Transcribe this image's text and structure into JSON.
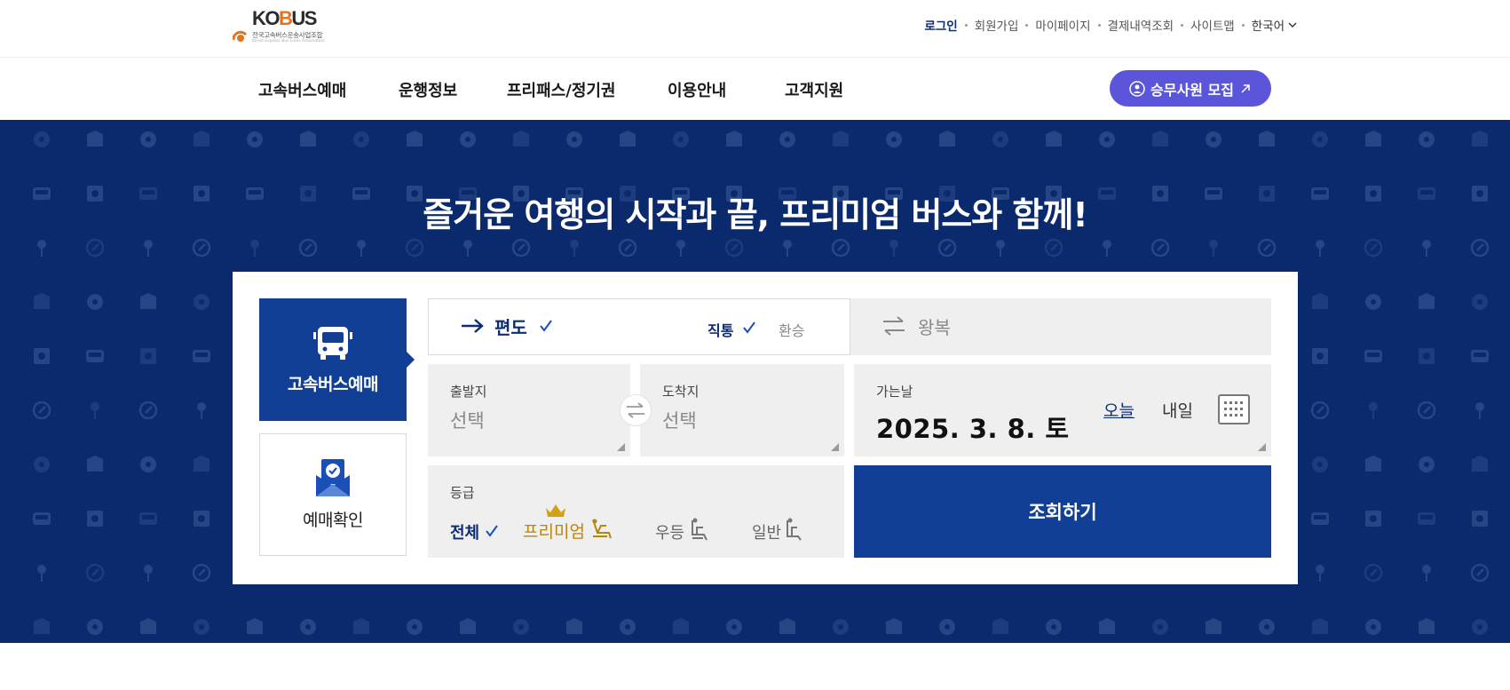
{
  "brand": {
    "logo_text_a": "KO",
    "logo_text_b": "B",
    "logo_text_c": "US",
    "logo_subtitle": "전국고속버스운송사업조합",
    "logo_subtitle_small": "Korea Express Bus Lines Association",
    "brand_color": "#0b2a6e",
    "accent_color": "#5a55d9"
  },
  "util_menu": {
    "login": "로그인",
    "signup": "회원가입",
    "mypage": "마이페이지",
    "payment_history": "결제내역조회",
    "sitemap": "사이트맵",
    "language": "한국어"
  },
  "nav": {
    "items": [
      "고속버스예매",
      "운행정보",
      "프리패스/정기권",
      "이용안내",
      "고객지원"
    ],
    "recruit_button": "승무사원 모집"
  },
  "hero": {
    "title": "즐거운 여행의 시작과 끝, 프리미엄 버스와 함께!"
  },
  "booking": {
    "side_tabs": {
      "reserve": "고속버스예매",
      "confirm": "예매확인"
    },
    "trip_type": {
      "oneway": "편도",
      "direct": "직통",
      "transfer": "환승",
      "roundtrip": "왕복"
    },
    "departure": {
      "label": "출발지",
      "value": "선택"
    },
    "arrival": {
      "label": "도착지",
      "value": "선택"
    },
    "date": {
      "label": "가는날",
      "value": "2025. 3. 8. 토",
      "today": "오늘",
      "tomorrow": "내일"
    },
    "grade": {
      "label": "등급",
      "all": "전체",
      "premium": "프리미엄",
      "first": "우등",
      "general": "일반"
    },
    "search_button": "조회하기"
  }
}
